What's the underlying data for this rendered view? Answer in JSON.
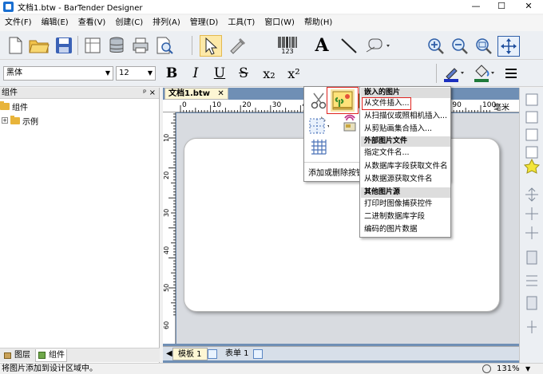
{
  "window": {
    "title": "文档1.btw - BarTender Designer",
    "min": "—",
    "max": "☐",
    "close": "✕"
  },
  "menu": [
    "文件(F)",
    "编辑(E)",
    "查看(V)",
    "创建(C)",
    "排列(A)",
    "管理(D)",
    "工具(T)",
    "窗口(W)",
    "帮助(H)"
  ],
  "toolbar": {
    "barcode_label": "123",
    "font_name": "黑体",
    "font_size": "12",
    "bold": "B",
    "italic": "I",
    "underline": "U",
    "strike": "S",
    "subscript": "x₂",
    "superscript": "x²",
    "text_tool": "A"
  },
  "left_panel": {
    "title": "组件",
    "pin": "ᵖ ×",
    "tree": [
      "组件",
      "示例"
    ],
    "tabs": [
      "图层",
      "组件"
    ]
  },
  "document": {
    "tab_label": "文档1.btw",
    "tab_close": "✕",
    "ruler_unit": "毫米",
    "ruler_top_ticks": [
      "0",
      "10",
      "20",
      "30",
      "40",
      "50",
      "60",
      "70",
      "80",
      "90",
      "100"
    ],
    "ruler_left_ticks": [
      "10",
      "20",
      "30",
      "40",
      "50",
      "60"
    ],
    "bottom_tabs": [
      "模板 1",
      "表单 1"
    ]
  },
  "popup": {
    "footer": "添加或删除按钮"
  },
  "submenu": {
    "sections": [
      {
        "header": "嵌入的图片",
        "items": [
          "从文件插入...",
          "从扫描仪或照相机插入...",
          "从剪贴画集合插入..."
        ]
      },
      {
        "header": "外部图片文件",
        "items": [
          "指定文件名...",
          "从数据库字段获取文件名",
          "从数据源获取文件名"
        ]
      },
      {
        "header": "其他图片源",
        "items": [
          "打印时图像捕获控件",
          "二进制数据库字段",
          "编码的图片数据"
        ]
      }
    ]
  },
  "status": {
    "text": "将图片添加到设计区域中。",
    "zoom": "131%"
  },
  "colors": {
    "highlight": "#e0231e",
    "doc_bg": "#6f8fb5"
  }
}
